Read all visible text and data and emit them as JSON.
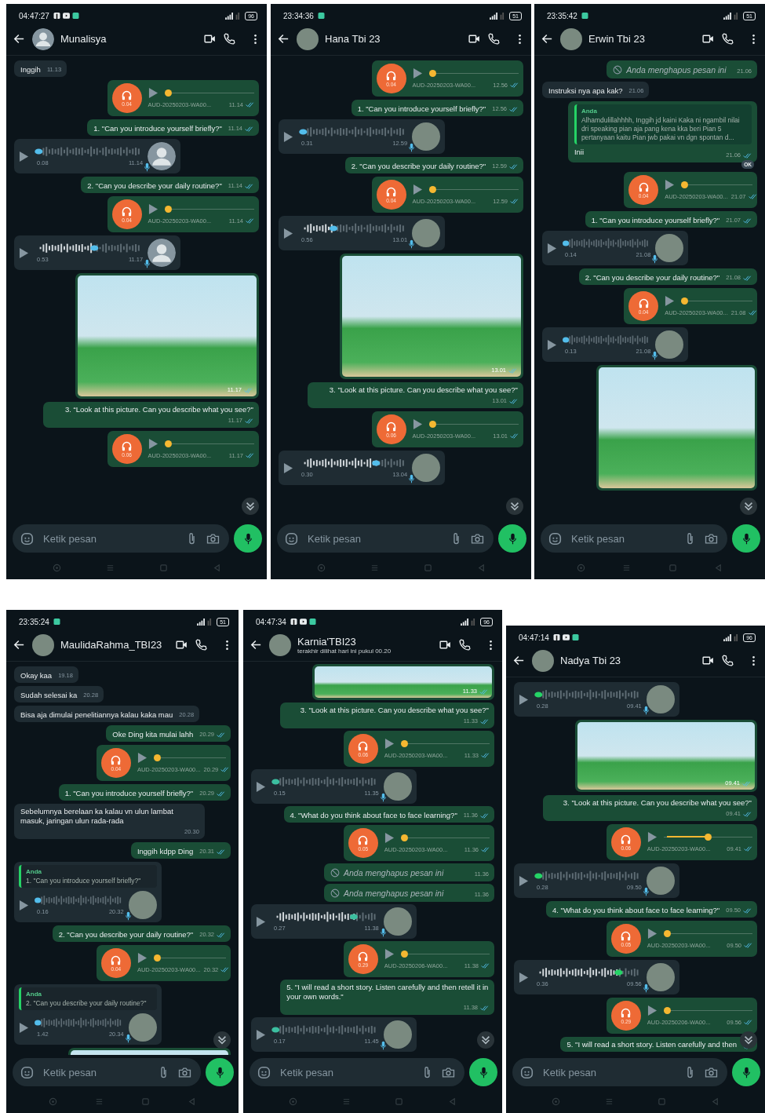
{
  "chats": [
    {
      "status": {
        "time": "04:47:27",
        "battery": "96",
        "kind": "full"
      },
      "contact": {
        "name": "Munalisya",
        "has_photo": false
      },
      "scroll_button": true,
      "input": {
        "placeholder": "Ketik pesan"
      },
      "messages": [
        {
          "kind": "text",
          "outgoing": false,
          "text": "Inggih",
          "time": "11.13"
        },
        {
          "kind": "audio",
          "duration": "0.04",
          "file": "AUD-20250203-WA00...",
          "time": "11.14",
          "level": 0
        },
        {
          "kind": "text",
          "outgoing": true,
          "text": "1. \"Can you introduce yourself briefly?\"",
          "time": "11.14"
        },
        {
          "kind": "voice",
          "duration": "0.08",
          "time": "11.14",
          "level": 0
        },
        {
          "kind": "text",
          "outgoing": true,
          "text": "2. \"Can you describe your daily routine?\"",
          "time": "11.14"
        },
        {
          "kind": "audio",
          "duration": "0.04",
          "file": "AUD-20250203-WA00...",
          "time": "11.14",
          "level": 0
        },
        {
          "kind": "voice",
          "duration": "0.53",
          "time": "11.17",
          "level": 0.55
        },
        {
          "kind": "image",
          "time": "11.17"
        },
        {
          "kind": "text",
          "outgoing": true,
          "text": "3. “Look at this picture. Can you describe what you see?\"",
          "time": "11.17"
        },
        {
          "kind": "audio",
          "duration": "0.06",
          "file": "AUD-20250203-WA00...",
          "time": "11.17",
          "level": 0
        }
      ]
    },
    {
      "status": {
        "time": "23:34:36",
        "battery": "51",
        "kind": "simple"
      },
      "contact": {
        "name": "Hana Tbi 23",
        "has_photo": true
      },
      "scroll_button": true,
      "input": {
        "placeholder": "Ketik pesan"
      },
      "messages": [
        {
          "kind": "audio",
          "duration": "0.04",
          "file": "AUD-20250203-WA00...",
          "time": "12.56",
          "level": 0
        },
        {
          "kind": "text",
          "outgoing": true,
          "text": "1. \"Can you introduce yourself briefly?\"",
          "time": "12.56"
        },
        {
          "kind": "voice",
          "duration": "0.31",
          "time": "12.59",
          "level": 0
        },
        {
          "kind": "text",
          "outgoing": true,
          "text": "2. \"Can you describe your daily routine?\"",
          "time": "12.59"
        },
        {
          "kind": "audio",
          "duration": "0.04",
          "file": "AUD-20250203-WA00...",
          "time": "12.59",
          "level": 0
        },
        {
          "kind": "voice",
          "duration": "0.56",
          "time": "13.01",
          "level": 0.3
        },
        {
          "kind": "image",
          "time": "13.01"
        },
        {
          "kind": "text",
          "outgoing": true,
          "text": "3. \"Look at this picture. Can you describe what you see?\"",
          "time": "13.01"
        },
        {
          "kind": "audio",
          "duration": "0.06",
          "file": "AUD-20250203-WA00...",
          "time": "13.01",
          "level": 0
        },
        {
          "kind": "voice",
          "duration": "0.30",
          "time": "13.04",
          "level": 0.72
        }
      ]
    },
    {
      "status": {
        "time": "23:35:42",
        "battery": "51",
        "kind": "simple"
      },
      "contact": {
        "name": "Erwin Tbi 23",
        "has_photo": true
      },
      "scroll_button": true,
      "input": {
        "placeholder": "Ketik pesan"
      },
      "messages": [
        {
          "kind": "deleted",
          "text": "Anda menghapus pesan ini",
          "time": "21.06"
        },
        {
          "kind": "text",
          "outgoing": false,
          "text": "Instruksi nya apa kak?",
          "time": "21.06"
        },
        {
          "kind": "reply",
          "author": "Anda",
          "quote": "Alhamdulillahhhh, Inggih jd kaini Kaka ni ngambil nilai dri speaking pian aja pang kena kka beri Pian 5 pertanyaan kaitu Pian jwb pakai vn dgn spontan d...",
          "text": "Inii",
          "time": "21.06",
          "reaction": "OK"
        },
        {
          "kind": "audio",
          "duration": "0.04",
          "file": "AUD-20250203-WA00...",
          "time": "21.07",
          "level": 0
        },
        {
          "kind": "text",
          "outgoing": true,
          "text": "1. \"Can you introduce yourself briefly?\"",
          "time": "21.07"
        },
        {
          "kind": "voice",
          "duration": "0.14",
          "time": "21.08",
          "level": 0
        },
        {
          "kind": "text",
          "outgoing": true,
          "text": "2. \"Can you describe your daily routine?\"",
          "time": "21.08"
        },
        {
          "kind": "audio",
          "duration": "0.04",
          "file": "AUD-20250203-WA00...",
          "time": "21.08",
          "level": 0
        },
        {
          "kind": "voice",
          "duration": "0.13",
          "time": "21.08",
          "level": 0
        },
        {
          "kind": "image"
        }
      ]
    },
    {
      "status": {
        "time": "23:35:24",
        "battery": "51",
        "kind": "simple"
      },
      "contact": {
        "name": "MaulidaRahma_TBI23",
        "has_photo": true
      },
      "scroll_button": true,
      "input": {
        "placeholder": "Ketik pesan"
      },
      "messages": [
        {
          "kind": "text",
          "outgoing": false,
          "text": "Okay kaa",
          "time": "19.18"
        },
        {
          "kind": "text",
          "outgoing": false,
          "text": "Sudah selesai ka",
          "time": "20.28"
        },
        {
          "kind": "text",
          "outgoing": false,
          "text": "Bisa aja dimulai penelitiannya kalau kaka mau",
          "time": "20.28"
        },
        {
          "kind": "text",
          "outgoing": true,
          "text": "Oke Ding kita mulai lahh",
          "time": "20.29"
        },
        {
          "kind": "audio",
          "duration": "0.04",
          "file": "AUD-20250203-WA00...",
          "time": "20.29",
          "level": 0
        },
        {
          "kind": "text",
          "outgoing": true,
          "text": "1. \"Can you introduce yourself briefly?\"",
          "time": "20.29"
        },
        {
          "kind": "text",
          "outgoing": false,
          "text": "Sebelumnya berelaan ka kalau vn ulun lambat masuk, jaringan ulun rada-rada",
          "time": "20.30"
        },
        {
          "kind": "text",
          "outgoing": true,
          "text": "Inggih kdpp Ding",
          "time": "20.31"
        },
        {
          "kind": "reply_voice",
          "author": "Anda",
          "quote": "1. \"Can you introduce yourself briefly?\"",
          "duration": "0.16",
          "time": "20.32",
          "level": 0
        },
        {
          "kind": "text",
          "outgoing": true,
          "text": "2. \"Can you describe your daily routine?\"",
          "time": "20.32"
        },
        {
          "kind": "audio",
          "duration": "0.04",
          "file": "AUD-20250203-WA00...",
          "time": "20.32",
          "level": 0
        },
        {
          "kind": "reply_voice",
          "author": "Anda",
          "quote": "2. \"Can you describe your daily routine?\"",
          "duration": "1.42",
          "time": "20.34",
          "level": 0
        },
        {
          "kind": "image"
        }
      ]
    },
    {
      "status": {
        "time": "04:47:34",
        "battery": "96",
        "kind": "full"
      },
      "contact": {
        "name": "Karnia'TBI23",
        "subtitle": "terakhir dilihat hari ini pukul 00.20",
        "has_photo": true
      },
      "scroll_button": true,
      "input": {
        "placeholder": "Ketik pesan"
      },
      "messages": [
        {
          "kind": "image",
          "time": "11.33"
        },
        {
          "kind": "text",
          "outgoing": true,
          "text": "3. \"Look at this picture. Can you describe what you see?\"",
          "time": "11.33"
        },
        {
          "kind": "audio",
          "duration": "0.06",
          "file": "AUD-20250203-WA00...",
          "time": "11.33",
          "level": 0
        },
        {
          "kind": "voice",
          "duration": "0.15",
          "time": "11.35",
          "level": 0
        },
        {
          "kind": "text",
          "outgoing": true,
          "text": "4. \"What do you think about face to face learning?\"",
          "time": "11.36"
        },
        {
          "kind": "audio",
          "duration": "0.05",
          "file": "AUD-20250203-WA00...",
          "time": "11.36",
          "level": 0
        },
        {
          "kind": "deleted",
          "text": "Anda menghapus pesan ini",
          "time": "11.36"
        },
        {
          "kind": "deleted",
          "text": "Anda menghapus pesan ini",
          "time": "11.36"
        },
        {
          "kind": "voice",
          "duration": "0.27",
          "time": "11.38",
          "level": 0.78
        },
        {
          "kind": "audio",
          "duration": "0.29",
          "file": "AUD-20250206-WA00...",
          "time": "11.38",
          "level": 0
        },
        {
          "kind": "text",
          "outgoing": true,
          "text": "5. \"I will read a short story. Listen carefully and then retell it in your own words.\"",
          "time": "11.38"
        },
        {
          "kind": "voice",
          "duration": "0.17",
          "time": "11.45",
          "level": 0
        }
      ]
    },
    {
      "status": {
        "time": "04:47:14",
        "battery": "96",
        "kind": "full"
      },
      "contact": {
        "name": "Nadya Tbi 23",
        "has_photo": true
      },
      "scroll_button": true,
      "input": {
        "placeholder": "Ketik pesan"
      },
      "messages": [
        {
          "kind": "voice",
          "duration": "0.28",
          "time": "09.41",
          "level": 0
        },
        {
          "kind": "image",
          "time": "09.41"
        },
        {
          "kind": "text",
          "outgoing": true,
          "text": "3. \"Look at this picture. Can you describe what you see?\"",
          "time": "09.41"
        },
        {
          "kind": "audio",
          "duration": "0.06",
          "file": "AUD-20250203-WA00...",
          "time": "09.41",
          "level": 0.5
        },
        {
          "kind": "voice",
          "duration": "0.28",
          "time": "09.50",
          "level": 0
        },
        {
          "kind": "text",
          "outgoing": true,
          "text": "4. \"What do you think about face to face learning?\"",
          "time": "09.50"
        },
        {
          "kind": "audio",
          "duration": "0.05",
          "file": "AUD-20250203-WA00...",
          "time": "09.50",
          "level": 0
        },
        {
          "kind": "voice",
          "duration": "0.36",
          "time": "09.56",
          "level": 0.8
        },
        {
          "kind": "audio",
          "duration": "0.29",
          "file": "AUD-20250206-WA00...",
          "time": "09.56",
          "level": 0
        },
        {
          "kind": "text",
          "outgoing": true,
          "text": "5. \"I will read a short story. Listen carefully and then"
        }
      ]
    }
  ]
}
